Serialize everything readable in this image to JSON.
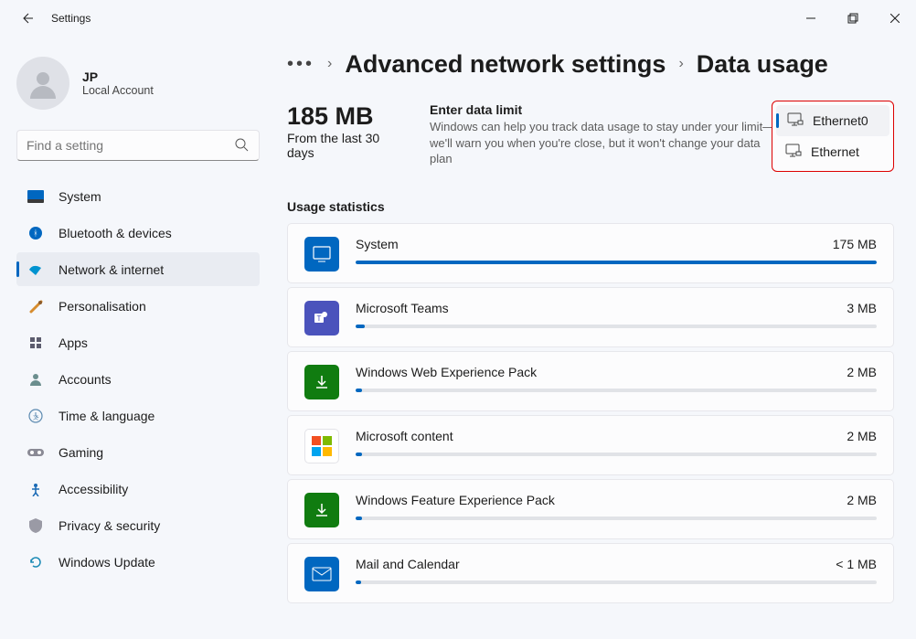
{
  "window": {
    "title": "Settings"
  },
  "profile": {
    "initials": "JP",
    "name": "JP",
    "type": "Local Account"
  },
  "search": {
    "placeholder": "Find a setting"
  },
  "sidebar": {
    "items": [
      {
        "label": "System"
      },
      {
        "label": "Bluetooth & devices"
      },
      {
        "label": "Network & internet"
      },
      {
        "label": "Personalisation"
      },
      {
        "label": "Apps"
      },
      {
        "label": "Accounts"
      },
      {
        "label": "Time & language"
      },
      {
        "label": "Gaming"
      },
      {
        "label": "Accessibility"
      },
      {
        "label": "Privacy & security"
      },
      {
        "label": "Windows Update"
      }
    ]
  },
  "breadcrumb": {
    "dots": "•••",
    "seg1": "Advanced network settings",
    "seg2": "Data usage"
  },
  "summary": {
    "total": "185 MB",
    "caption": "From the last 30 days",
    "limit_title": "Enter data limit",
    "limit_desc": "Windows can help you track data usage to stay under your limit—we'll warn you when you're close, but it won't change your data plan"
  },
  "adapter_dropdown": {
    "options": [
      {
        "label": "Ethernet0",
        "selected": true
      },
      {
        "label": "Ethernet",
        "selected": false
      }
    ]
  },
  "usage": {
    "section_title": "Usage statistics",
    "max_mb": 175,
    "items": [
      {
        "name": "System",
        "amount": "175 MB",
        "mb": 175,
        "icon_bg": "#0067c0",
        "fg": "#ffffff"
      },
      {
        "name": "Microsoft Teams",
        "amount": "3 MB",
        "mb": 3,
        "icon_bg": "#4b53bc",
        "fg": "#ffffff"
      },
      {
        "name": "Windows Web Experience Pack",
        "amount": "2 MB",
        "mb": 2,
        "icon_bg": "#107c10",
        "fg": "#ffffff"
      },
      {
        "name": "Microsoft content",
        "amount": "2 MB",
        "mb": 2,
        "icon_bg": "ms",
        "fg": ""
      },
      {
        "name": "Windows Feature Experience Pack",
        "amount": "2 MB",
        "mb": 2,
        "icon_bg": "#107c10",
        "fg": "#ffffff"
      },
      {
        "name": "Mail and Calendar",
        "amount": "< 1 MB",
        "mb": 0.5,
        "icon_bg": "#0067c0",
        "fg": "#ffffff"
      }
    ]
  }
}
